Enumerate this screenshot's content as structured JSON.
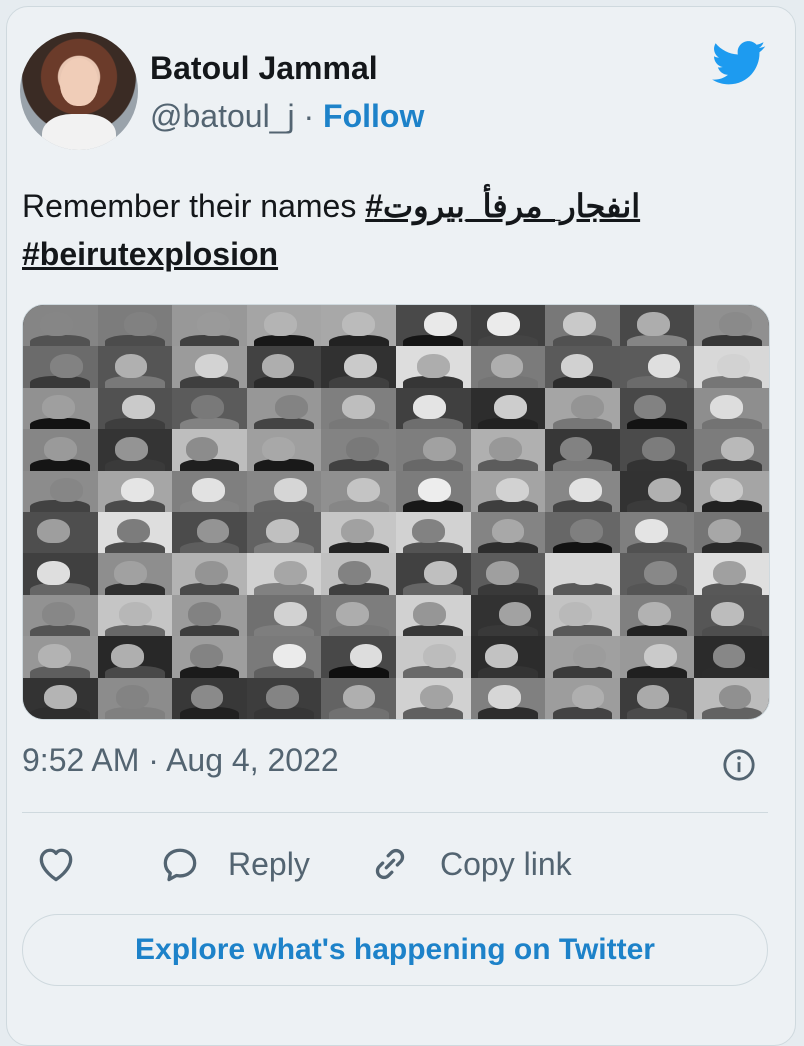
{
  "author": {
    "name": "Batoul Jammal",
    "handle": "@batoul_j",
    "separator": "·",
    "follow_label": "Follow"
  },
  "tweet": {
    "text_prefix": "Remember their names ",
    "hashtag_arabic": "#انفجار_مرفأ_بيروت",
    "hashtag_english": "#beirutexplosion"
  },
  "media": {
    "description_icon": "photo-collage-grayscale"
  },
  "meta": {
    "timestamp": "9:52 AM · Aug 4, 2022"
  },
  "actions": {
    "like_icon": "heart-icon",
    "reply_label": "Reply",
    "copy_link_label": "Copy link"
  },
  "explore_label": "Explore what's happening on Twitter",
  "colors": {
    "accent": "#1d9bf0",
    "link": "#1d82c9",
    "secondary_text": "#536471",
    "border": "#cfd9de",
    "background": "#edf1f4"
  }
}
